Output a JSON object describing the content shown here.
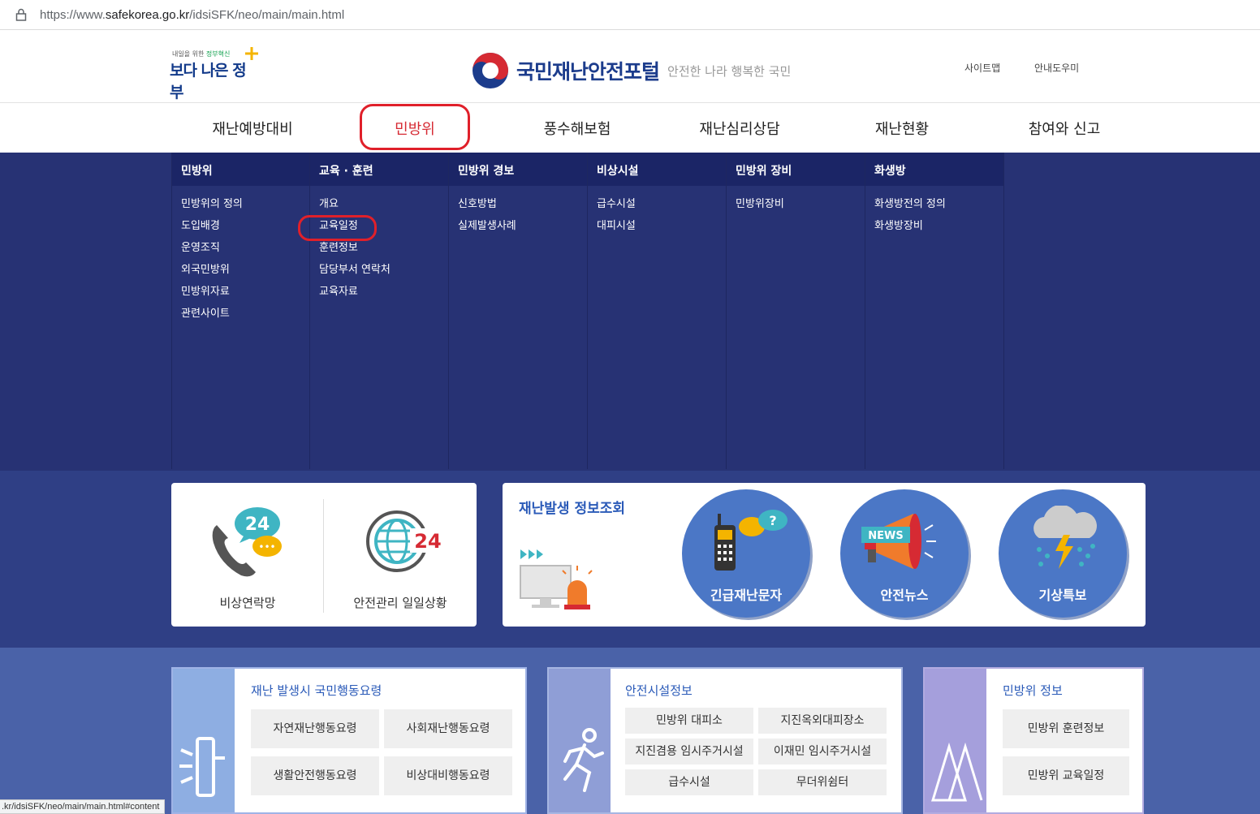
{
  "browser": {
    "url_prefix": "https://www.",
    "url_domain": "safekorea.go.kr",
    "url_path": "/idsiSFK/neo/main/main.html"
  },
  "header": {
    "gov_logo_small_1": "내일을 위한 ",
    "gov_logo_small_2": "정부혁신",
    "gov_logo_big": "보다 나은 정부",
    "portal_title": "국민재난안전포털",
    "portal_slogan": "안전한 나라 행복한 국민",
    "sitemap": "사이트맵",
    "guide": "안내도우미"
  },
  "gnb": [
    {
      "label": "재난예방대비"
    },
    {
      "label": "민방위"
    },
    {
      "label": "풍수해보험"
    },
    {
      "label": "재난심리상담"
    },
    {
      "label": "재난현황"
    },
    {
      "label": "참여와 신고"
    }
  ],
  "mega": [
    {
      "head": "민방위",
      "items": [
        "민방위의 정의",
        "도입배경",
        "운영조직",
        "외국민방위",
        "민방위자료",
        "관련사이트"
      ]
    },
    {
      "head": "교육 · 훈련",
      "items": [
        "개요",
        "교육일정",
        "훈련정보",
        "담당부서 연락처",
        "교육자료"
      ]
    },
    {
      "head": "민방위 경보",
      "items": [
        "신호방법",
        "실제발생사례"
      ]
    },
    {
      "head": "비상시설",
      "items": [
        "급수시설",
        "대피시설"
      ]
    },
    {
      "head": "민방위 장비",
      "items": [
        "민방위장비"
      ]
    },
    {
      "head": "화생방",
      "items": [
        "화생방전의 정의",
        "화생방장비"
      ]
    }
  ],
  "quick": {
    "left": [
      {
        "label": "비상연락망",
        "badge": "24"
      },
      {
        "label": "안전관리 일일상황",
        "badge": "24"
      }
    ],
    "disaster_heading": "재난발생 정보조회",
    "circles": [
      {
        "label": "긴급재난문자"
      },
      {
        "label": "안전뉴스",
        "badge": "NEWS"
      },
      {
        "label": "기상특보"
      }
    ]
  },
  "bottom": [
    {
      "title": "재난 발생시 국민행동요령",
      "buttons": [
        "자연재난행동요령",
        "사회재난행동요령",
        "생활안전행동요령",
        "비상대비행동요령"
      ]
    },
    {
      "title": "안전시설정보",
      "buttons": [
        "민방위 대피소",
        "지진옥외대피장소",
        "지진겸용 임시주거시설",
        "이재민 임시주거시설",
        "급수시설",
        "무더위쉼터"
      ]
    },
    {
      "title": "민방위 정보",
      "buttons": [
        "민방위 훈련정보",
        "민방위 교육일정"
      ]
    }
  ],
  "status_bar": ".kr/idsiSFK/neo/main/main.html#content",
  "colors": {
    "accent_red": "#e0202a",
    "menu_bg": "#273274",
    "menu_head": "#1b2566",
    "circle_blue": "#4b77c6",
    "title_blue": "#2a5ab8"
  }
}
